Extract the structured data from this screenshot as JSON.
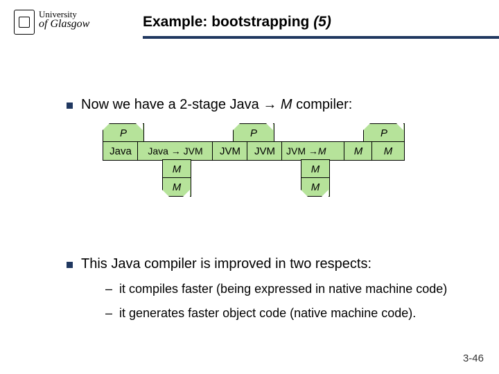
{
  "logo": {
    "line1": "University",
    "line2": "of Glasgow"
  },
  "title": {
    "prefix": "Example: bootstrapping ",
    "suffix": "(5)"
  },
  "bullets": {
    "b1_a": "Now we have a 2-stage Java → ",
    "b1_m": "M",
    "b1_b": " compiler:",
    "b2": "This Java compiler is improved in two respects:"
  },
  "subs": {
    "s1": "it compiles faster (being expressed in native machine code)",
    "s2": "it generates faster object code (native machine code)."
  },
  "dash": "–",
  "diagram": {
    "P": "P",
    "Java": "Java",
    "JavaToJVM": "Java → JVM",
    "JVM": "JVM",
    "JVMtoM": "JVM → ",
    "M": "M"
  },
  "pagenum": "3-46"
}
